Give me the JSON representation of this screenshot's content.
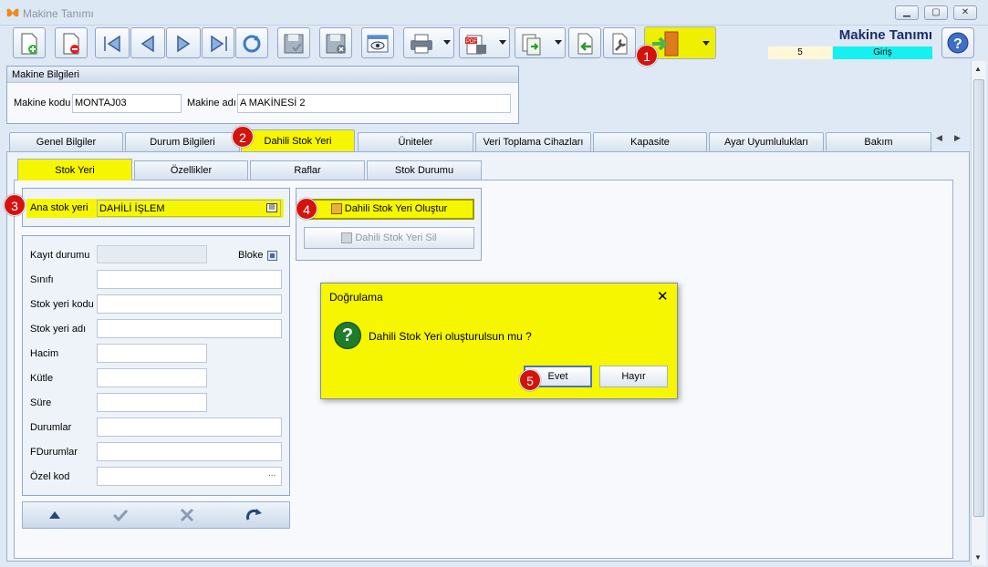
{
  "window": {
    "title": "Makine Tanımı"
  },
  "header": {
    "title": "Makine Tanımı",
    "record_no": "5",
    "mode": "Giriş"
  },
  "group_makine": {
    "title": "Makine Bilgileri",
    "code_label": "Makine kodu",
    "code_value": "MONTAJ03",
    "name_label": "Makine adı",
    "name_value": "A MAKİNESİ 2"
  },
  "main_tabs": [
    {
      "label": "Genel Bilgiler"
    },
    {
      "label": "Durum Bilgileri"
    },
    {
      "label": "Dahili Stok Yeri"
    },
    {
      "label": "Üniteler"
    },
    {
      "label": "Veri Toplama Cihazları"
    },
    {
      "label": "Kapasite"
    },
    {
      "label": "Ayar Uyumlulukları"
    },
    {
      "label": "Bakım"
    }
  ],
  "sub_tabs": [
    {
      "label": "Stok Yeri"
    },
    {
      "label": "Özellikler"
    },
    {
      "label": "Raflar"
    },
    {
      "label": "Stok Durumu"
    }
  ],
  "stock": {
    "main_label": "Ana stok yeri",
    "main_value": "DAHİLİ İŞLEM"
  },
  "form": {
    "status_label": "Kayıt durumu",
    "block_label": "Bloke",
    "fields": [
      {
        "label": "Sınıfı"
      },
      {
        "label": "Stok yeri kodu"
      },
      {
        "label": "Stok yeri adı"
      },
      {
        "label": "Hacim"
      },
      {
        "label": "Kütle"
      },
      {
        "label": "Süre"
      },
      {
        "label": "Durumlar"
      },
      {
        "label": "FDurumlar"
      },
      {
        "label": "Özel kod"
      }
    ],
    "ellipsis": "..."
  },
  "actions": {
    "create_label": "Dahili Stok Yeri Oluştur",
    "delete_label": "Dahili Stok Yeri Sil"
  },
  "dialog": {
    "title": "Doğrulama",
    "close": "✕",
    "icon": "?",
    "message": "Dahili Stok Yeri oluşturulsun mu ?",
    "yes_label": "Evet",
    "no_label": "Hayır"
  },
  "badges": [
    "1",
    "2",
    "3",
    "4",
    "5"
  ],
  "colors": {
    "highlight": "#f6f600",
    "badge": "#d2130f",
    "mode_bg": "#15f0f0"
  }
}
